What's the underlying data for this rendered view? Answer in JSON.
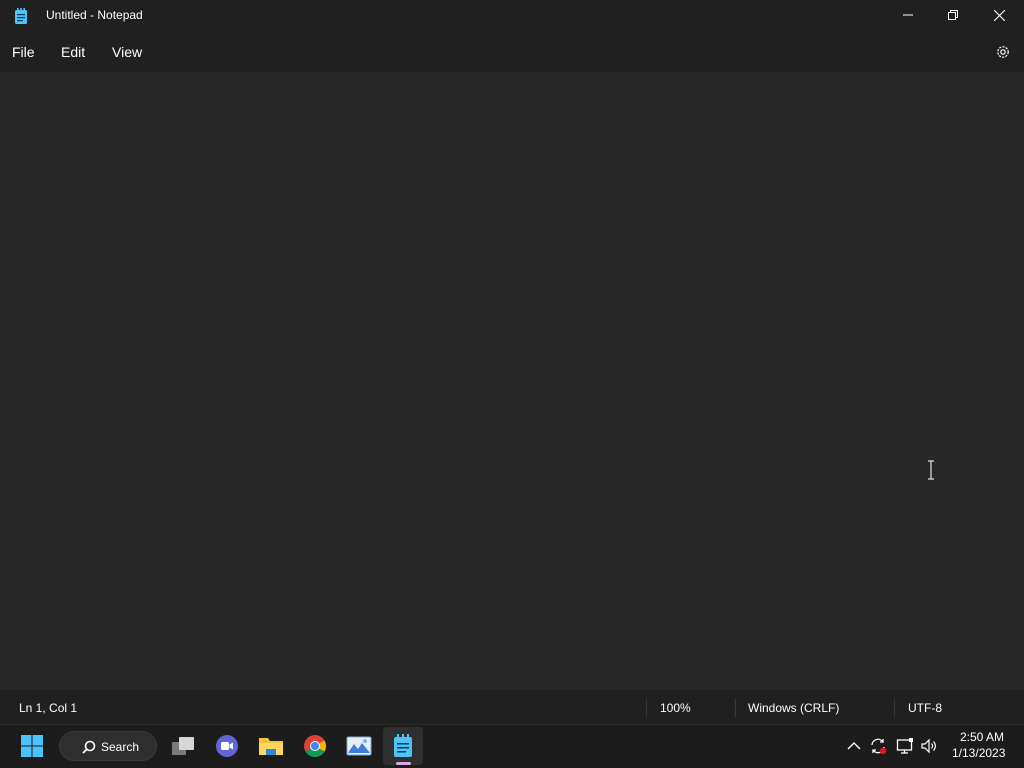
{
  "window": {
    "title": "Untitled - Notepad"
  },
  "menu": {
    "file": "File",
    "edit": "Edit",
    "view": "View"
  },
  "editor": {
    "content": ""
  },
  "status": {
    "position": "Ln 1, Col 1",
    "zoom": "100%",
    "line_endings": "Windows (CRLF)",
    "encoding": "UTF-8"
  },
  "taskbar": {
    "search_label": "Search",
    "pinned": [
      "start-icon",
      "search-icon",
      "task-view-icon",
      "teams-chat-icon",
      "file-explorer-icon",
      "chrome-icon",
      "photos-icon",
      "notepad-icon"
    ],
    "active_indicator_color": "#d9a6e6"
  },
  "tray": {
    "time": "2:50 AM",
    "date": "1/13/2023",
    "icons": [
      "chevron-up-icon",
      "sync-icon",
      "network-icon",
      "volume-icon"
    ]
  },
  "colors": {
    "titlebar": "#202020",
    "editor_bg": "#272727",
    "taskbar": "#1c1c1c"
  }
}
